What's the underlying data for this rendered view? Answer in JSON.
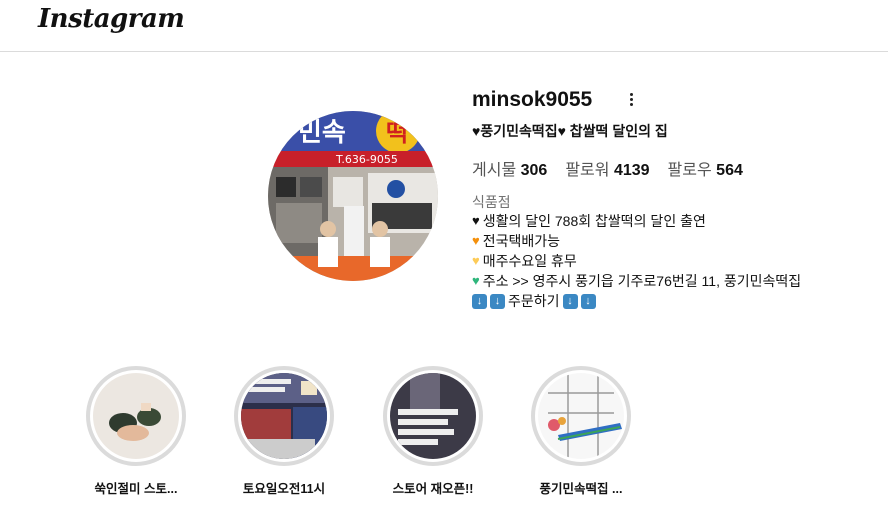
{
  "app": {
    "logo": "Instagram"
  },
  "profile": {
    "username": "minsok9055",
    "display_name": "♥풍기민속떡집♥ 찹쌀떡 달인의 집",
    "stats": {
      "posts_label": "게시물",
      "posts_value": "306",
      "followers_label": "팔로워",
      "followers_value": "4139",
      "following_label": "팔로우",
      "following_value": "564"
    },
    "category": "식품점",
    "bio": [
      {
        "icon": "black-heart-icon",
        "text": "생활의 달인 788회 찹쌀떡의 달인 출연"
      },
      {
        "icon": "orange-heart-icon",
        "text": "전국택배가능"
      },
      {
        "icon": "yellow-heart-icon",
        "text": "매주수요일 휴무"
      },
      {
        "icon": "green-heart-icon",
        "text": "주소 >> 영주시 풍기읍 기주로76번길 11, 풍기민속떡집"
      },
      {
        "icon": "down-arrow-icon",
        "text": "주문하기"
      }
    ],
    "avatar_sign": {
      "title": "민속",
      "badge": "떡",
      "phone": "T.636-9055"
    }
  },
  "highlights": [
    {
      "label": "쑥인절미 스토..."
    },
    {
      "label": "토요일오전11시"
    },
    {
      "label": "스토어 재오픈!!"
    },
    {
      "label": "풍기민속떡집 ..."
    }
  ],
  "colors": {
    "border": "#dbdbdb",
    "orange_heart": "#f4900c",
    "yellow_heart": "#fdcb58",
    "green_heart": "#2fb67c",
    "arrow_blue": "#3b88c3"
  }
}
